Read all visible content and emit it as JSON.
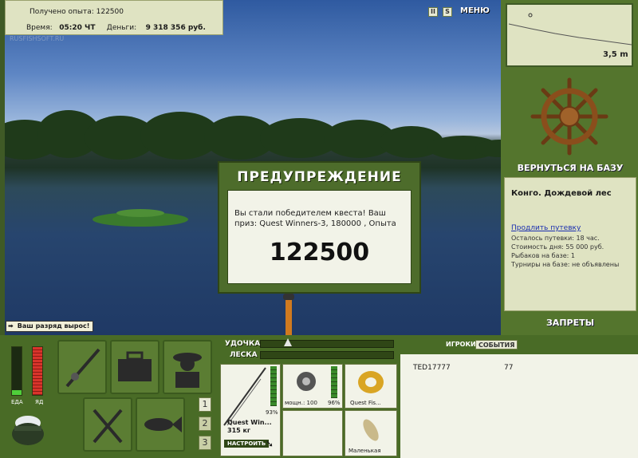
{
  "info": {
    "exp_label": "Получено опыта:",
    "exp_value": "122500",
    "time_label": "Время:",
    "time_value": "05:20 ЧТ",
    "money_label": "Деньги:",
    "money_value": "9 318 356 руб."
  },
  "watermark": "RUSFISHSOFT.RU",
  "top_buttons": {
    "pause": "II",
    "sound": "S",
    "menu": "МЕНЮ"
  },
  "depth": {
    "value": "3,5 m"
  },
  "right": {
    "return_base": "ВЕРНУТЬСЯ НА БАЗУ",
    "location": "Конго. Дождевой лес",
    "extend_link": "Продлить путевку",
    "lines": [
      "Осталось путевки: 18 час.",
      "Стоимость дня: 55 000 руб.",
      "Рыбаков на базе: 1",
      "Турниры на базе: не объявлены"
    ],
    "bans": "ЗАПРЕТЫ"
  },
  "dialog": {
    "title": "ПРЕДУПРЕЖДЕНИЕ",
    "message": "Вы стали победителем квеста! Ваш приз: Quest Winners-3, 180000 , Опыта",
    "number": "122500"
  },
  "rank_badge": "Ваш разряд вырос!",
  "status": {
    "food_label": "ЕДА",
    "poison_label": "ЯД",
    "food_level": 0.1,
    "poison_level": 1.0
  },
  "tabs": [
    "1",
    "2",
    "3"
  ],
  "tackle": {
    "rod_label": "УДОЧКА",
    "line_label": "ЛЕСКА",
    "rod_name": "Quest Win...",
    "rod_weight": "315 кг",
    "rod_percent": "93%",
    "setup_button": "НАСТРОИТЬ",
    "reel_power": "мощн.: 100",
    "reel_percent": "96%",
    "line_name": "Quest Fis...",
    "lure_name": "Маленькая"
  },
  "events": {
    "tab_players": "ИГРОКИ",
    "tab_events": "СОБЫТИЯ",
    "rows": [
      {
        "name": "TED17777",
        "value": "77"
      }
    ]
  },
  "colors": {
    "panel": "#dfe3c2",
    "frame": "#496b26",
    "accent": "#3f5a26"
  }
}
